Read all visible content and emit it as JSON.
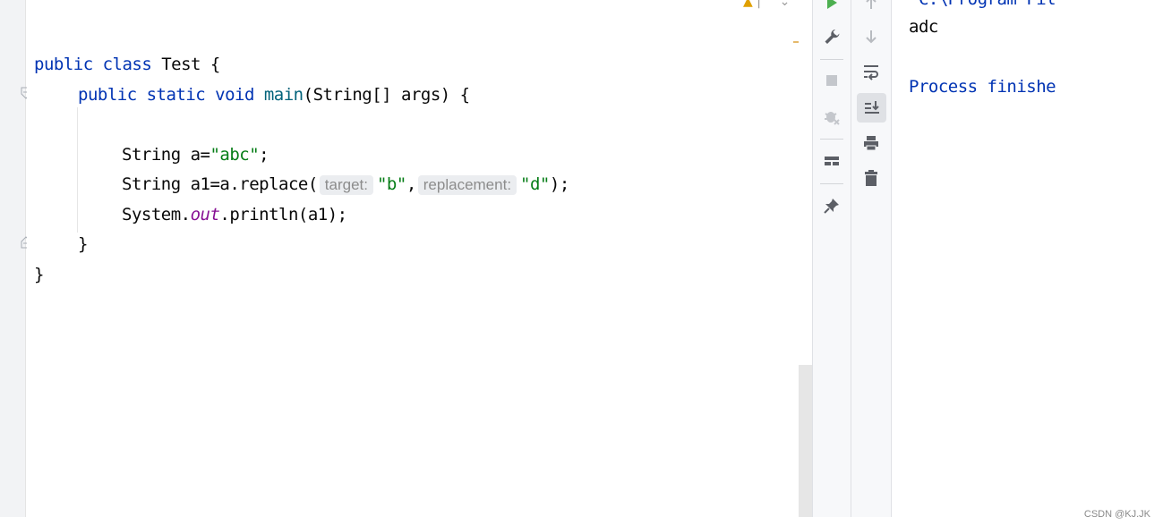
{
  "editor": {
    "lines": [
      {
        "tokens": [
          {
            "t": "public ",
            "c": "kw"
          },
          {
            "t": "class ",
            "c": "kw"
          },
          {
            "t": "Test {",
            "c": ""
          }
        ]
      },
      {
        "tokens": [
          {
            "t": "public ",
            "c": "kw"
          },
          {
            "t": "static ",
            "c": "kw"
          },
          {
            "t": "void ",
            "c": "kw"
          },
          {
            "t": "main",
            "c": "fn"
          },
          {
            "t": "(String[] args) {",
            "c": ""
          }
        ]
      },
      {
        "tokens": [
          {
            "t": "String a=",
            "c": ""
          },
          {
            "t": "\"abc\"",
            "c": "str"
          },
          {
            "t": ";",
            "c": ""
          }
        ]
      },
      {
        "tokens": [
          {
            "t": "String a1=a.replace(",
            "c": ""
          },
          {
            "t": "target:",
            "c": "hint"
          },
          {
            "t": "\"b\"",
            "c": "str"
          },
          {
            "t": ",",
            "c": ""
          },
          {
            "t": "replacement:",
            "c": "hint"
          },
          {
            "t": "\"d\"",
            "c": "str"
          },
          {
            "t": ");",
            "c": ""
          }
        ]
      },
      {
        "tokens": [
          {
            "t": "System.",
            "c": ""
          },
          {
            "t": "out",
            "c": "static-field"
          },
          {
            "t": ".println(a1);",
            "c": ""
          }
        ]
      },
      {
        "tokens": [
          {
            "t": "}",
            "c": ""
          }
        ]
      },
      {
        "tokens": [
          {
            "t": "}",
            "c": ""
          }
        ]
      }
    ],
    "top_icons": {
      "warning": "▲",
      "sep": "|",
      "up_down": "⌃ ⌄"
    }
  },
  "toolbar_left": {
    "icons": [
      "rerun-icon",
      "wrench-icon",
      "stop-icon",
      "debug-icon",
      "layout-icon",
      "pin-icon"
    ]
  },
  "toolbar_right": {
    "icons": [
      "up-arrow-icon",
      "down-arrow-icon",
      "soft-wrap-icon",
      "scroll-to-end-icon",
      "print-icon",
      "trash-icon"
    ]
  },
  "console": {
    "cmd_line": "\"C:\\Program Fil",
    "output": "adc",
    "status": "Process finishe"
  },
  "watermark": "CSDN @KJ.JK",
  "colors": {
    "keyword": "#0033b3",
    "string": "#067d17",
    "method": "#00627a",
    "static_field": "#871094",
    "hint_bg": "#ebedf0"
  }
}
